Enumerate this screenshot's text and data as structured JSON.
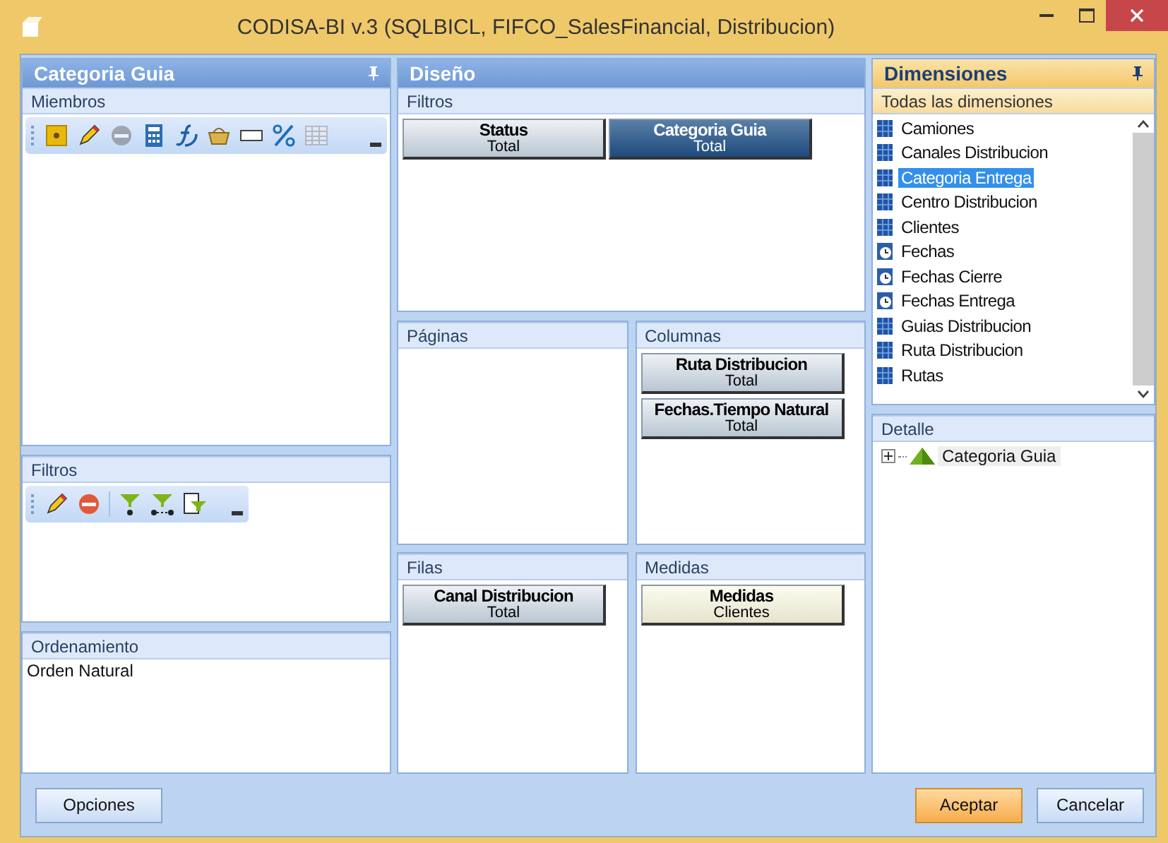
{
  "window": {
    "title": "CODISA-BI v.3 (SQLBICL, FIFCO_SalesFinancial, Distribucion)"
  },
  "left": {
    "title": "Categoria Guia",
    "members": {
      "label": "Miembros",
      "tools": [
        {
          "kind": "member",
          "disabled": false
        },
        {
          "kind": "edit",
          "disabled": false
        },
        {
          "kind": "remove",
          "disabled": true
        },
        {
          "kind": "calc",
          "disabled": false
        },
        {
          "kind": "formula",
          "disabled": false
        },
        {
          "kind": "basket",
          "disabled": false
        },
        {
          "kind": "blank",
          "disabled": false
        },
        {
          "kind": "percent",
          "disabled": false
        },
        {
          "kind": "grid",
          "disabled": true
        }
      ]
    },
    "filters": {
      "label": "Filtros",
      "tools": [
        {
          "kind": "edit",
          "disabled": false
        },
        {
          "kind": "remove",
          "disabled": false
        },
        {
          "kind": "filter",
          "disabled": false
        },
        {
          "kind": "filter-range",
          "disabled": false
        },
        {
          "kind": "filter-list",
          "disabled": false
        }
      ]
    },
    "sorting": {
      "label": "Ordenamiento",
      "value": "Orden Natural"
    }
  },
  "design": {
    "title": "Diseño",
    "filters": {
      "label": "Filtros",
      "fields": [
        {
          "name": "Status",
          "sub": "Total",
          "kind": "dimension",
          "selected": false
        },
        {
          "name": "Categoria Guia",
          "sub": "Total",
          "kind": "dimension",
          "selected": true
        }
      ]
    },
    "pages": {
      "label": "Páginas"
    },
    "columns": {
      "label": "Columnas",
      "fields": [
        {
          "name": "Ruta Distribucion",
          "sub": "Total",
          "kind": "dimension",
          "selected": false
        },
        {
          "name": "Fechas.Tiempo Natural",
          "sub": "Total",
          "kind": "dimension",
          "selected": false
        }
      ]
    },
    "rows": {
      "label": "Filas",
      "fields": [
        {
          "name": "Canal Distribucion",
          "sub": "Total",
          "kind": "dimension",
          "selected": false
        }
      ]
    },
    "measures": {
      "label": "Medidas",
      "fields": [
        {
          "name": "Medidas",
          "sub": "Clientes",
          "kind": "measure",
          "selected": false
        }
      ]
    }
  },
  "dimensions": {
    "title": "Dimensiones",
    "subtitle": "Todas las dimensiones",
    "items": [
      {
        "label": "Camiones",
        "kind": "cube",
        "selected": false
      },
      {
        "label": "Canales Distribucion",
        "kind": "cube",
        "selected": false
      },
      {
        "label": "Categoria Entrega",
        "kind": "cube",
        "selected": true
      },
      {
        "label": "Centro Distribucion",
        "kind": "cube",
        "selected": false
      },
      {
        "label": "Clientes",
        "kind": "cube",
        "selected": false
      },
      {
        "label": "Fechas",
        "kind": "time",
        "selected": false
      },
      {
        "label": "Fechas Cierre",
        "kind": "time",
        "selected": false
      },
      {
        "label": "Fechas Entrega",
        "kind": "time",
        "selected": false
      },
      {
        "label": "Guias Distribucion",
        "kind": "cube",
        "selected": false
      },
      {
        "label": "Ruta Distribucion",
        "kind": "cube",
        "selected": false
      },
      {
        "label": "Rutas",
        "kind": "cube",
        "selected": false
      }
    ]
  },
  "detail": {
    "label": "Detalle",
    "tree": [
      {
        "label": "Categoria Guia",
        "expanded": false
      }
    ]
  },
  "buttons": [
    {
      "label": "Opciones",
      "kind": "normal"
    },
    {
      "label": "Aceptar",
      "kind": "default"
    },
    {
      "label": "Cancelar",
      "kind": "normal"
    }
  ]
}
